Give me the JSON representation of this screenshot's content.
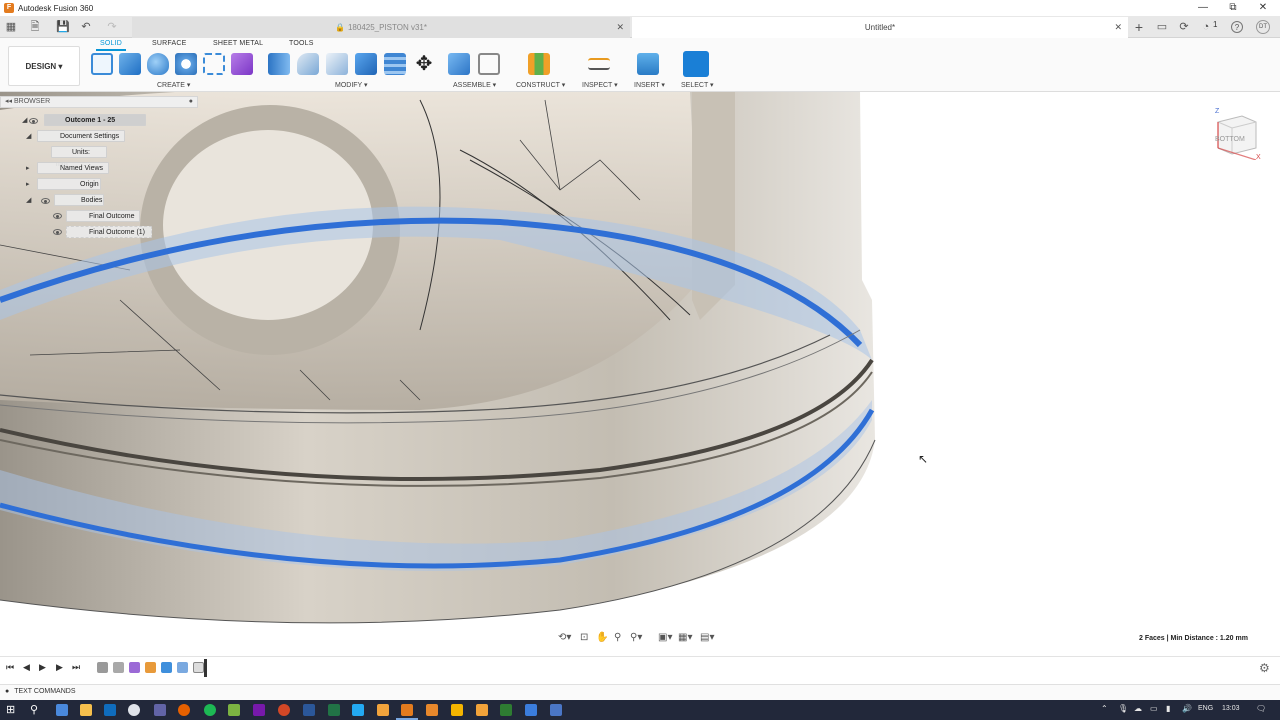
{
  "window": {
    "app_title": "Autodesk Fusion 360",
    "controls": {
      "minimize": "—",
      "restore": "⧉",
      "close": "✕"
    }
  },
  "tabs": {
    "inactive_label": "180425_PISTON v31*",
    "active_label": "Untitled*",
    "close_glyph": "✕",
    "lock_glyph": "🔒",
    "new_tab_glyph": "+",
    "notification_count": "1",
    "help_glyph": "?",
    "user_initials": "DT"
  },
  "ribbon": {
    "workspace": "DESIGN ▾",
    "tabs": [
      "SOLID",
      "SURFACE",
      "SHEET METAL",
      "TOOLS"
    ],
    "active_tab": "SOLID",
    "groups": {
      "create": "CREATE ▾",
      "modify": "MODIFY ▾",
      "assemble": "ASSEMBLE ▾",
      "construct": "CONSTRUCT ▾",
      "inspect": "INSPECT ▾",
      "insert": "INSERT ▾",
      "select": "SELECT ▾"
    }
  },
  "browser": {
    "header": "BROWSER",
    "header_collapse": "◂◂",
    "header_toggle": "●",
    "root": "Outcome 1 - 25",
    "items": {
      "document_settings": "Document Settings",
      "units": "Units: mm",
      "named_views": "Named Views",
      "origin": "Origin",
      "bodies": "Bodies",
      "body_1": "Final Outcome",
      "body_2": "Final Outcome (1)"
    }
  },
  "viewcube": {
    "face_label": "BOTTOM",
    "z_axis": "Z",
    "x_axis": "X"
  },
  "status": {
    "measure_result": "2 Faces | Min Distance : 1.20 mm"
  },
  "timeline": {
    "controls": [
      "⏮",
      "◀",
      "▶",
      "▶",
      "⏭"
    ]
  },
  "text_commands": {
    "label": "TEXT COMMANDS"
  },
  "taskbar": {
    "language": "ENG",
    "time": "13:03"
  },
  "colors": {
    "accent": "#0696d7",
    "highlight_ring": "#2f6fd6",
    "metal": "#c9c3b8",
    "taskbar": "#22283a"
  }
}
